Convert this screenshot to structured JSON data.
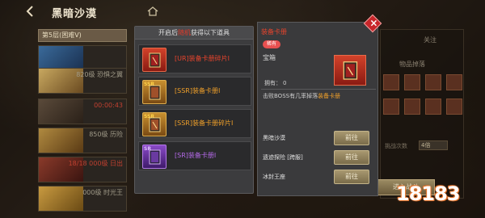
{
  "header": {
    "title": "黑暗沙漠"
  },
  "left_panel": {
    "floor_select": "第5层(困难V)",
    "cards": [
      {
        "text": "",
        "red": false
      },
      {
        "text": "820级 恐惧之翼",
        "red": false
      },
      {
        "text": "00:00:43",
        "red": true
      },
      {
        "text": "850级 历险",
        "red": false
      },
      {
        "text": "18/18 000级 日出",
        "red": true
      },
      {
        "text": "000级 时光王",
        "red": false
      }
    ]
  },
  "center_popup": {
    "header_prefix": "开启后",
    "header_highlight": "随机",
    "header_suffix": "获得以下道具",
    "rewards": [
      {
        "name": "[UR]装备卡册碎片I",
        "rarity": "ur",
        "tag": ""
      },
      {
        "name": "[SSR]装备卡册I",
        "rarity": "ssr",
        "tag": "SSR"
      },
      {
        "name": "[SSR]装备卡册碎片I",
        "rarity": "ssr",
        "tag": "SSR"
      },
      {
        "name": "[SR]装备卡册I",
        "rarity": "sr",
        "tag": "SR"
      }
    ]
  },
  "detail_popup": {
    "title": "装备卡册",
    "badge": "稀有",
    "type": "宝箱",
    "own_label": "拥有：",
    "own_value": "0",
    "desc_prefix": "击败BOSS有几率掉落",
    "desc_highlight": "装备卡册",
    "sources": [
      {
        "name": "黑暗沙漠",
        "button": "前往"
      },
      {
        "name": "遗迹探险 [跨服]",
        "button": "前往"
      },
      {
        "name": "冰封王座",
        "button": "前往"
      }
    ],
    "close_glyph": "×"
  },
  "right_panel": {
    "follow": "关注",
    "drop_label": "物品掉落",
    "times_label": "挑战次数",
    "times_value": "4倍",
    "enter_button": "进入战斗"
  },
  "watermark": {
    "text": "18183"
  },
  "colors": {
    "ur": "#e8442c",
    "ssr": "#f0a02a",
    "sr": "#b46ae8",
    "accent_red": "#c8262a"
  }
}
